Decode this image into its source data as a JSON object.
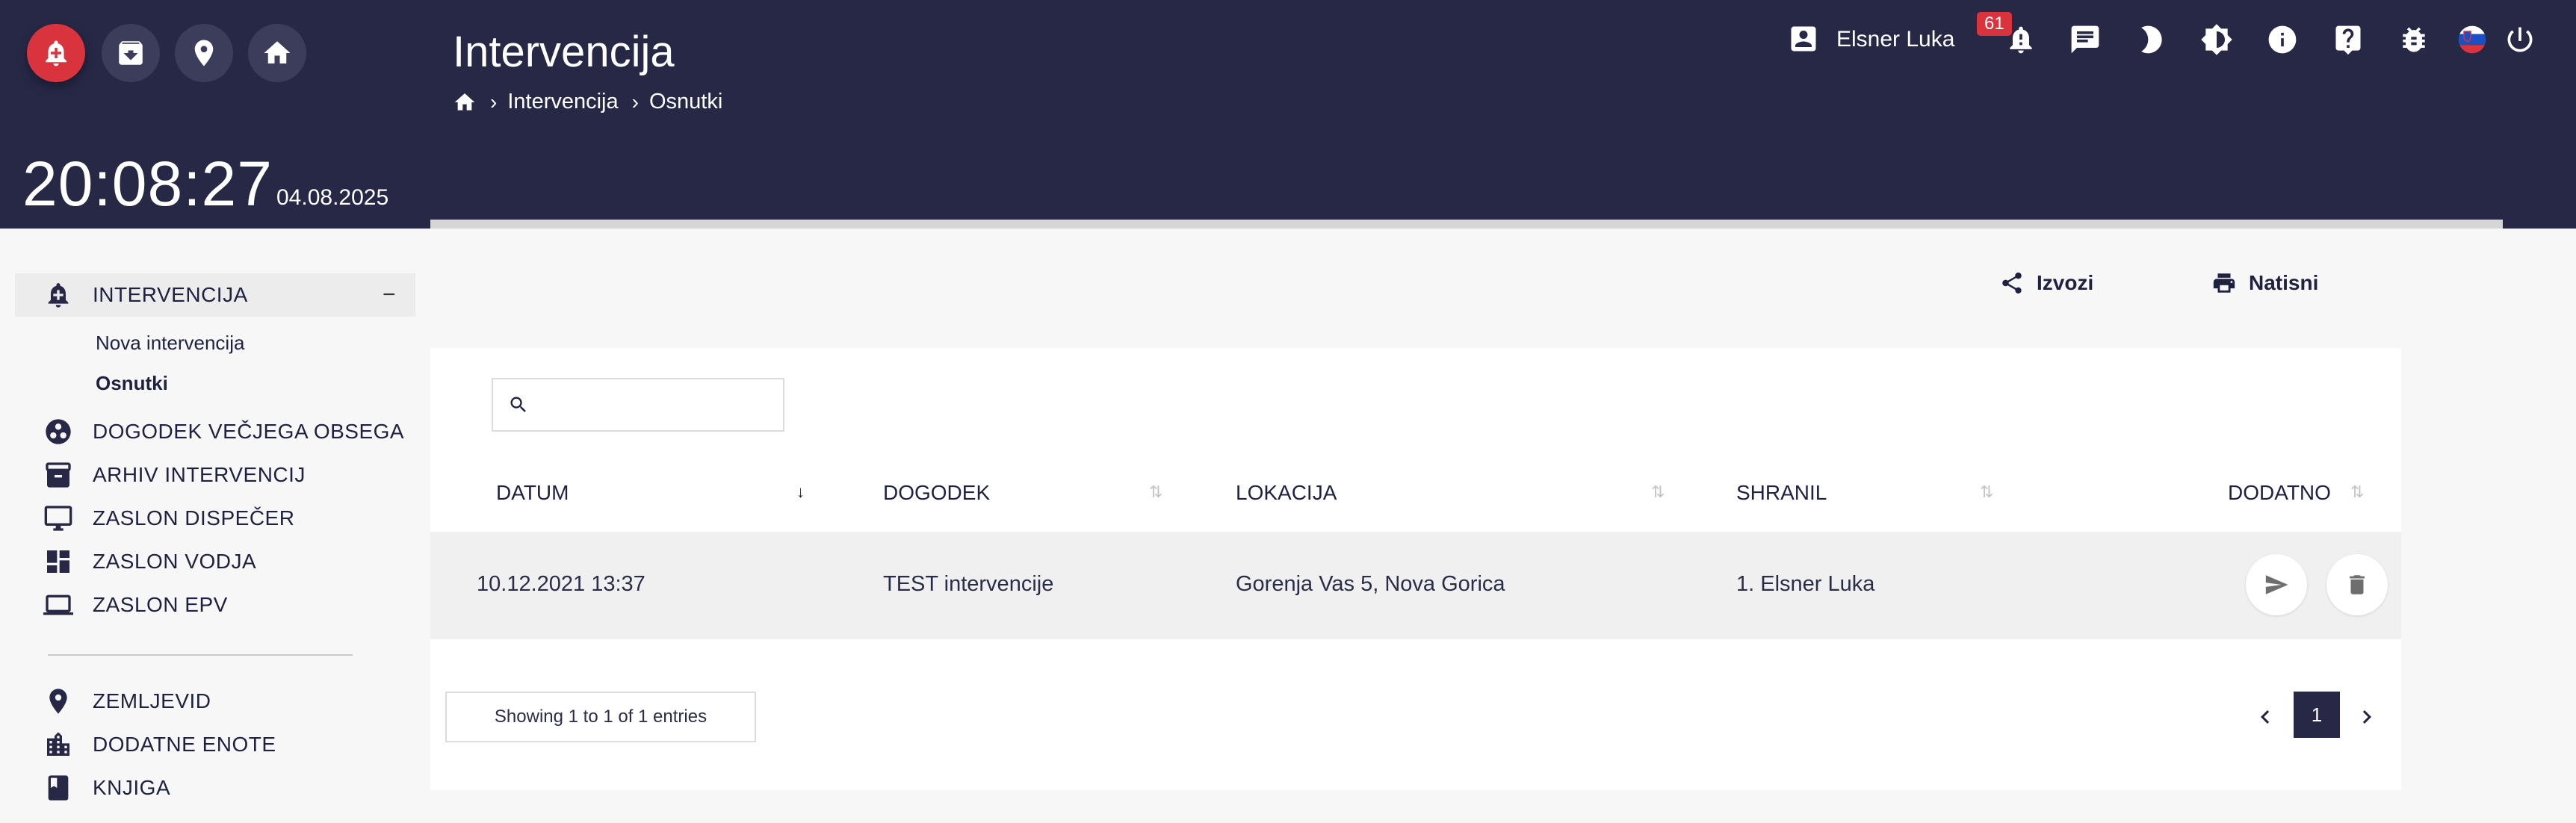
{
  "header": {
    "clock": "20:08:27",
    "date": "04.08.2025",
    "title": "Intervencija",
    "breadcrumb": [
      "Intervencija",
      "Osnutki"
    ],
    "user_name": "Elsner Luka",
    "notification_count": "61"
  },
  "quick_actions": [
    "new-intervention-icon",
    "archive-icon",
    "location-icon",
    "home-icon"
  ],
  "sidebar": {
    "active_group": "INTERVENCIJA",
    "sub_items": [
      "Nova intervencija",
      "Osnutki"
    ],
    "items": [
      "DOGODEK VEČJEGA OBSEGA",
      "ARHIV INTERVENCIJ",
      "ZASLON DISPEČER",
      "ZASLON VODJA",
      "ZASLON EPV"
    ],
    "items_bottom": [
      "ZEMLJEVID",
      "DODATNE ENOTE",
      "KNJIGA"
    ]
  },
  "actions": {
    "export_label": "Izvozi",
    "print_label": "Natisni"
  },
  "table": {
    "search_placeholder": "",
    "columns": [
      "DATUM",
      "DOGODEK",
      "LOKACIJA",
      "SHRANIL",
      "DODATNO"
    ],
    "rows": [
      [
        "10.12.2021 13:37",
        "TEST intervencije",
        "Gorenja Vas 5, Nova Gorica",
        "1. Elsner Luka"
      ]
    ],
    "info": "Showing 1 to 1 of 1 entries",
    "current_page": "1"
  },
  "colors": {
    "header_bg": "#262846",
    "accent_red": "#d9343e"
  }
}
